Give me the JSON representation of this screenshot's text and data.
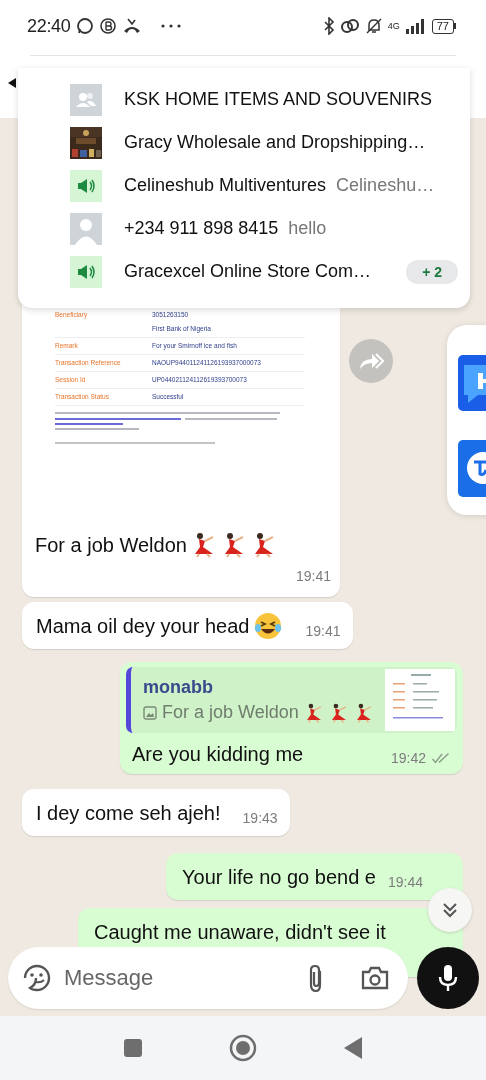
{
  "status_bar": {
    "time": "22:40",
    "network": "4G",
    "battery": "77"
  },
  "mention_popup": {
    "items": [
      {
        "kind": "group",
        "name": "KSK HOME ITEMS AND SOUVENIRS"
      },
      {
        "name": "Gracy Wholesale and Dropshipping…"
      },
      {
        "kind": "channel",
        "name": "Celineshub Multiventures",
        "subtitle": "Celineshu…"
      },
      {
        "kind": "person",
        "name": "+234 911 898 8415",
        "subtitle": "hello"
      },
      {
        "kind": "channel",
        "name": "Gracexcel Online Store Com…",
        "badge": "+ 2"
      }
    ]
  },
  "messages": [
    {
      "kind": "receipt",
      "outgoing": false,
      "receipt_rows": [
        {
          "label": "Beneficiary",
          "values": [
            "3051263150",
            "First Bank of Nigeria"
          ]
        },
        {
          "label": "Remark",
          "values": [
            "For your Smirnoff ice and fish"
          ]
        },
        {
          "label": "Transaction Reference",
          "values": [
            "NAOUP944011241126193937000073"
          ]
        },
        {
          "label": "Session Id",
          "values": [
            "UP044021124112619393700073"
          ]
        },
        {
          "label": "Transaction Status",
          "values": [
            "Successful"
          ]
        }
      ],
      "text": "For a job Weldon",
      "icons": [
        {
          "kind": "dancer"
        },
        {
          "kind": "dancer"
        },
        {
          "kind": "dancer"
        }
      ],
      "time": "19:41"
    },
    {
      "kind": "text",
      "outgoing": false,
      "text": "Mama oil dey your head",
      "icons": [
        {
          "kind": "laughing"
        }
      ],
      "time": "19:41"
    },
    {
      "kind": "reply",
      "outgoing": true,
      "quote": {
        "author": "monabb",
        "text": "For a job Weldon",
        "icons": [
          {
            "kind": "dancer"
          },
          {
            "kind": "dancer"
          },
          {
            "kind": "dancer"
          }
        ]
      },
      "text": "Are you kidding me",
      "time": "19:42",
      "read": false
    },
    {
      "kind": "text",
      "outgoing": false,
      "text": "I dey come seh ajeh!",
      "time": "19:43"
    },
    {
      "kind": "text",
      "outgoing": true,
      "text": "Your life no go bend e",
      "time": "19:44"
    },
    {
      "kind": "text",
      "outgoing": true,
      "text": "Caught me unaware, didn't see it"
    }
  ],
  "composer": {
    "placeholder": "Message"
  }
}
